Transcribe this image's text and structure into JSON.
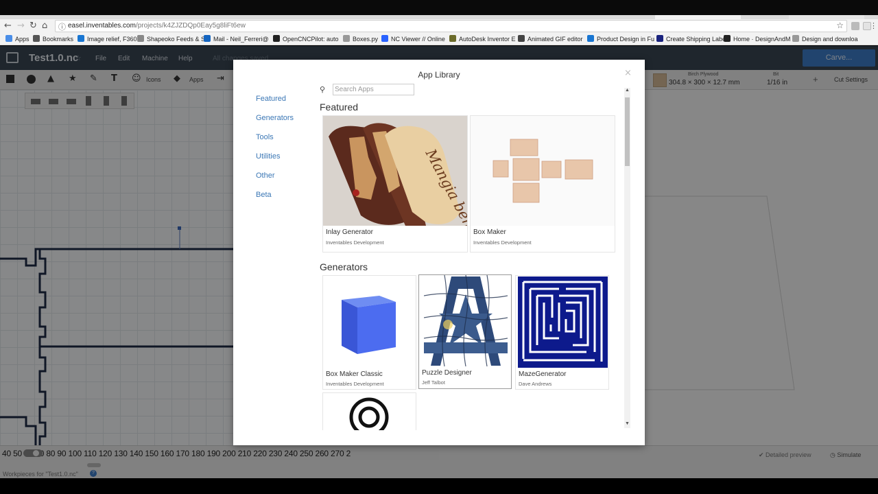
{
  "browser": {
    "url_host": "easel.inventables.com",
    "url_path": "/projects/k4ZJZDQp0Eay5g8liFt6ew",
    "bookmarks": [
      {
        "label": "Apps",
        "color": "#4a8ee8"
      },
      {
        "label": "Bookmarks",
        "color": "#555555"
      },
      {
        "label": "Image relief, F360",
        "color": "#1976d2"
      },
      {
        "label": "Shapeoko Feeds & S",
        "color": "#888888"
      },
      {
        "label": "Mail - Neil_Ferreri@",
        "color": "#1565c0"
      },
      {
        "label": "OpenCNCPilot: auto",
        "color": "#222222"
      },
      {
        "label": "Boxes.py",
        "color": "#999999"
      },
      {
        "label": "NC Viewer // Online",
        "color": "#2962ff"
      },
      {
        "label": "AutoDesk Inventor E",
        "color": "#6b6b2a"
      },
      {
        "label": "Animated GIF editor",
        "color": "#444444"
      },
      {
        "label": "Product Design in Fu",
        "color": "#1976d2"
      },
      {
        "label": "Create Shipping Labe",
        "color": "#1a237e"
      },
      {
        "label": "Home · DesignAndM",
        "color": "#222222"
      },
      {
        "label": "Design and downloa",
        "color": "#999999"
      }
    ]
  },
  "app": {
    "title": "Test1.0.nc",
    "menu": [
      "File",
      "Edit",
      "Machine",
      "Help"
    ],
    "save_status": "All changes saved",
    "carve_label": "Carve...",
    "toolbar": {
      "icons_label": "Icons",
      "apps_label": "Apps",
      "material_name": "Birch Plywood",
      "material_size": "304.8 × 300 × 12.7 mm",
      "bit_label": "Bit",
      "bit_value": "1/16 in",
      "cut_settings": "Cut Settings"
    },
    "ruler_text": "40 50 60 70  80  90 100 110 120 130 140 150 160 170 180 190 200 210 220 230 240 250 260 270 2",
    "detailed_preview": "Detailed preview",
    "simulate": "Simulate",
    "workpieces": "Workpieces for \"Test1.0.nc\""
  },
  "modal": {
    "title": "App Library",
    "close": "×",
    "sidebar": [
      "Featured",
      "Generators",
      "Tools",
      "Utilities",
      "Other",
      "Beta"
    ],
    "search_placeholder": "Search Apps",
    "featured_heading": "Featured",
    "generators_heading": "Generators",
    "featured_cards": [
      {
        "name": "Inlay Generator",
        "author": "Inventables Development"
      },
      {
        "name": "Box Maker",
        "author": "Inventables Development"
      }
    ],
    "generator_cards": [
      {
        "name": "Box Maker Classic",
        "author": "Inventables Development"
      },
      {
        "name": "Puzzle Designer",
        "author": "Jeff Talbot"
      },
      {
        "name": "MazeGenerator",
        "author": "Dave Andrews"
      }
    ],
    "inlay_thumb_text": "Mangia bene"
  },
  "colors": {
    "app_header": "#394553",
    "link_blue": "#3b77b5",
    "carve_button": "#3d7cc9",
    "maze_blue": "#0d1a8c"
  }
}
